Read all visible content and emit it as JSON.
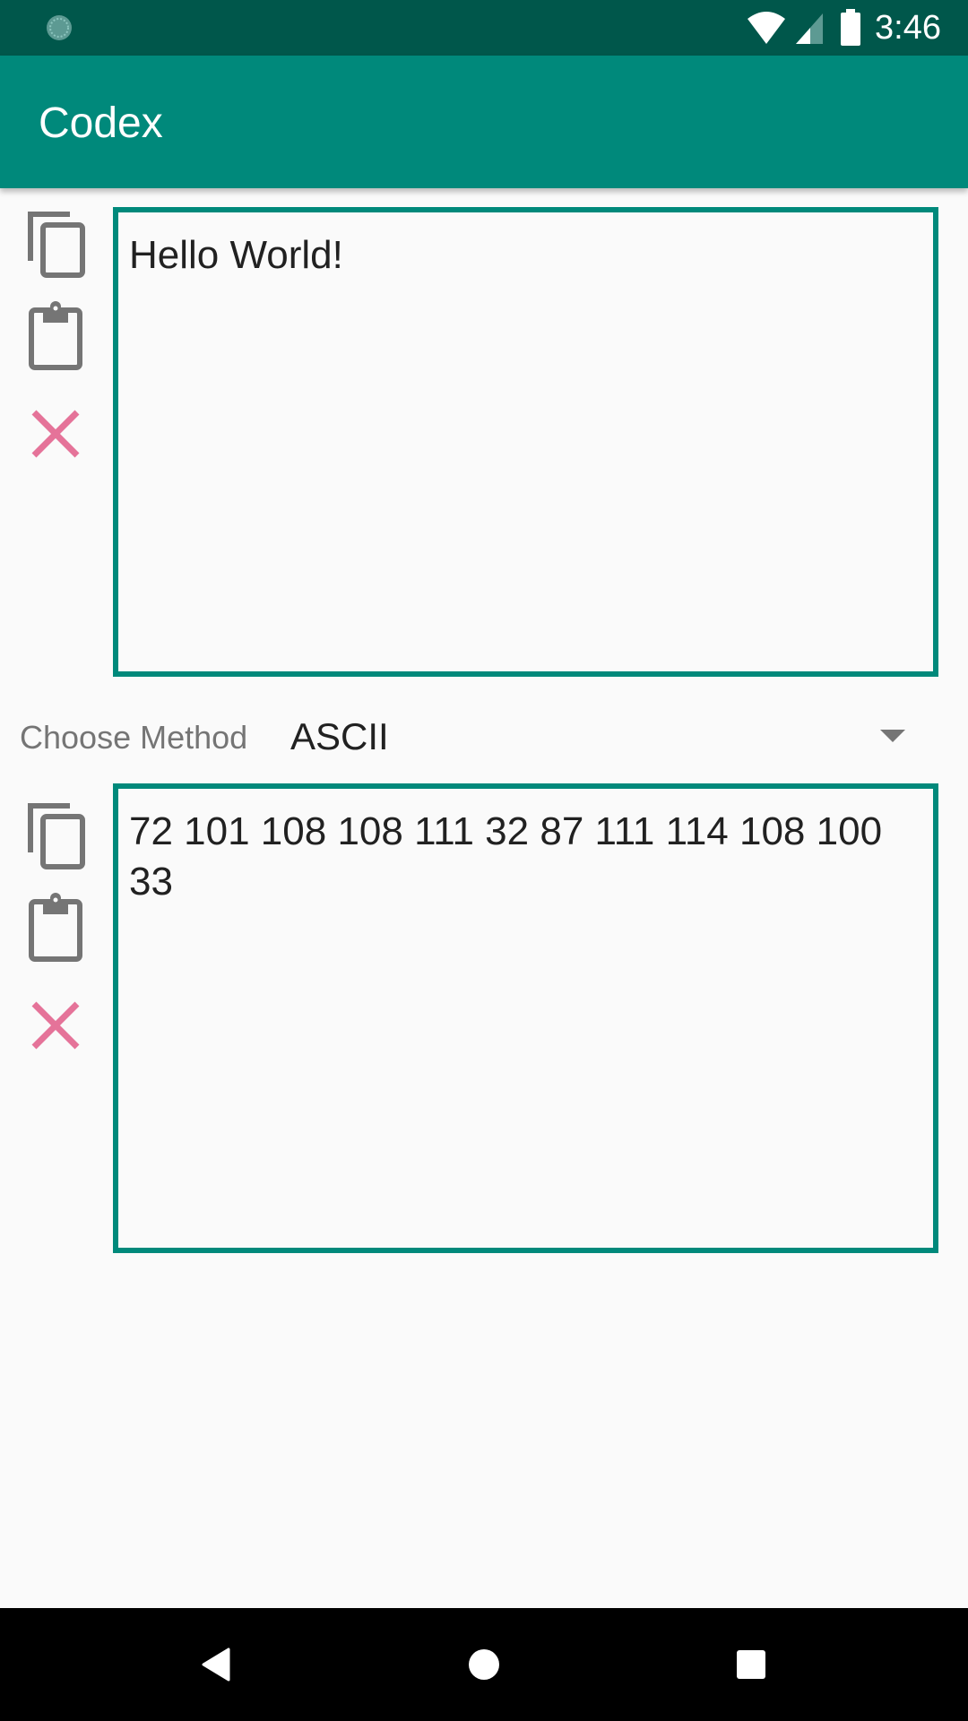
{
  "status_bar": {
    "time": "3:46",
    "icons": [
      "sync-icon",
      "wifi-icon",
      "signal-icon",
      "battery-icon"
    ]
  },
  "app_bar": {
    "title": "Codex"
  },
  "input_panel": {
    "text": "Hello World!",
    "actions": [
      "copy-icon",
      "paste-icon",
      "clear-icon"
    ]
  },
  "method": {
    "label": "Choose Method",
    "selected": "ASCII"
  },
  "output_panel": {
    "text": "72 101 108 108 111 32 87 111 114 108 100 33",
    "actions": [
      "copy-icon",
      "paste-icon",
      "clear-icon"
    ]
  },
  "nav_bar": {
    "buttons": [
      "back",
      "home",
      "recents"
    ]
  },
  "colors": {
    "primary": "#00897b",
    "primary_dark": "#00574b",
    "clear_accent": "#e57399",
    "icon_gray": "#757575"
  }
}
